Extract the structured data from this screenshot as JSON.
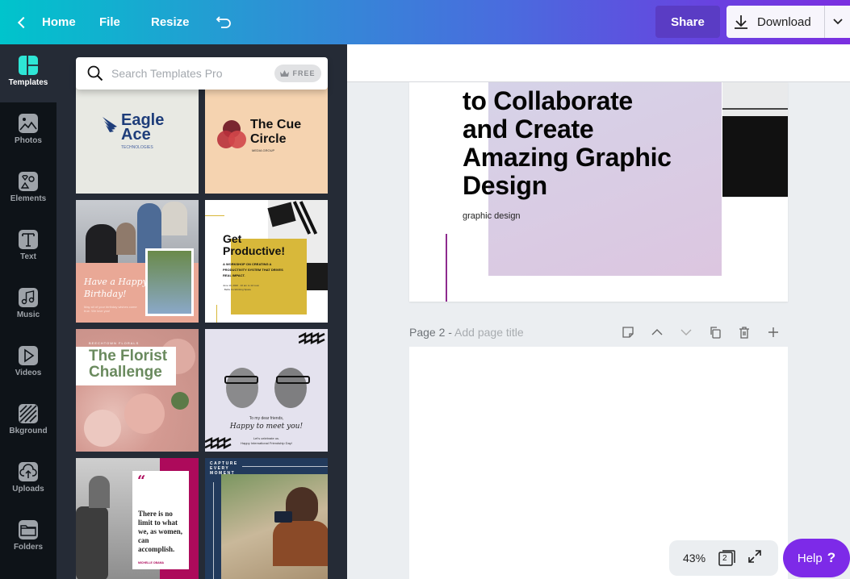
{
  "topbar": {
    "home_label": "Home",
    "file_label": "File",
    "resize_label": "Resize",
    "undo_icon": "undo-icon",
    "share_label": "Share",
    "download_label": "Download",
    "gradient": [
      "#00c4cc",
      "#7b2fe0"
    ]
  },
  "sidebar": {
    "items": [
      {
        "label": "Templates",
        "icon": "templates-icon",
        "active": true
      },
      {
        "label": "Photos",
        "icon": "photos-icon"
      },
      {
        "label": "Elements",
        "icon": "elements-icon"
      },
      {
        "label": "Text",
        "icon": "text-icon"
      },
      {
        "label": "Music",
        "icon": "music-icon"
      },
      {
        "label": "Videos",
        "icon": "videos-icon"
      },
      {
        "label": "Bkground",
        "icon": "background-icon"
      },
      {
        "label": "Uploads",
        "icon": "uploads-icon"
      },
      {
        "label": "Folders",
        "icon": "folders-icon"
      }
    ],
    "accent": "#2ee6d6"
  },
  "panel": {
    "search_placeholder": "Search Templates Pro",
    "free_badge": "FREE",
    "templates": [
      {
        "name": "eagle-ace",
        "title1": "Eagle",
        "title2": "Ace",
        "subtitle": "TECHNOLOGIES"
      },
      {
        "name": "the-cue-circle",
        "title1": "The Cue",
        "title2": "Circle",
        "subtitle": "MEDIA GROUP"
      },
      {
        "name": "happy-birthday",
        "title1": "Have a Happy",
        "title2": "Birthday!",
        "subtitle": "May all of your birthday wishes come true. We love you!"
      },
      {
        "name": "get-productive",
        "title1": "Get",
        "title2": "Productive!",
        "subtitle": "A WORKSHOP ON CREATING A PRODUCTIVITY SYSTEM THAT DRIVES REAL IMPACT.",
        "details": "June 10, 2020 · 10 am to 12 noon · Bellis Co-Working Space"
      },
      {
        "name": "florist-challenge",
        "kicker": "BEECHTOWN FLORALS",
        "title1": "The Florist",
        "title2": "Challenge"
      },
      {
        "name": "friendship-day",
        "line1": "To my dear friends,",
        "title1": "Happy to meet you!",
        "line2": "Let's celebrate us.",
        "line3": "Happy International Friendship Day!"
      },
      {
        "name": "quote-michelle-obama",
        "quote": "There is no limit to what we, as women, can accomplish.",
        "author": "MICHELLE OBAMA"
      },
      {
        "name": "capture-every-moment",
        "title1": "CAPTURE",
        "title2": "EVERY",
        "title3": "MOMENT"
      }
    ]
  },
  "canvas": {
    "page1": {
      "headline": [
        "to Collaborate",
        "and Create",
        "Amazing Graphic",
        "Design"
      ],
      "subtitle": "graphic design"
    },
    "page2": {
      "label": "Page 2 - ",
      "title_placeholder": "Add page title"
    },
    "zoom": "43%",
    "page_count": "2",
    "help_label": "Help",
    "help_symbol": "?"
  }
}
